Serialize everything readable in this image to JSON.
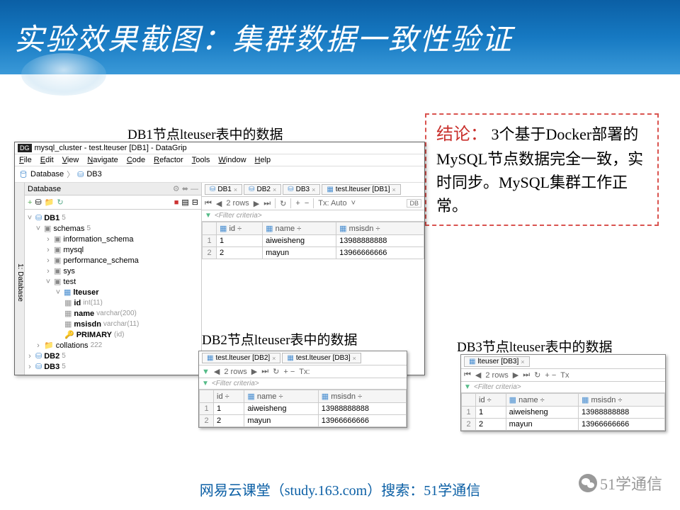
{
  "slide": {
    "title": "实验效果截图：集群数据一致性验证",
    "caption_db1": "DB1节点lteuser表中的数据",
    "caption_db2": "DB2节点lteuser表中的数据",
    "caption_db3": "DB3节点lteuser表中的数据"
  },
  "conclusion": {
    "lead": "结论：",
    "body": "3个基于Docker部署的MySQL节点数据完全一致，实时同步。MySQL集群工作正常。"
  },
  "datagrip": {
    "logo": "DG",
    "title": "mysql_cluster - test.lteuser [DB1] - DataGrip",
    "menu": [
      "File",
      "Edit",
      "View",
      "Navigate",
      "Code",
      "Refactor",
      "Tools",
      "Window",
      "Help"
    ],
    "breadcrumb": [
      "Database",
      "DB3"
    ],
    "panel_tab": "Database",
    "side_tab": "1: Database",
    "tree": {
      "db1": {
        "label": "DB1",
        "count": "5"
      },
      "schemas": {
        "label": "schemas",
        "count": "5"
      },
      "sch": [
        "information_schema",
        "mysql",
        "performance_schema",
        "sys",
        "test"
      ],
      "table": "lteuser",
      "cols": [
        {
          "n": "id",
          "t": "int(11)"
        },
        {
          "n": "name",
          "t": "varchar(200)"
        },
        {
          "n": "msisdn",
          "t": "varchar(11)"
        }
      ],
      "pk": {
        "n": "PRIMARY",
        "t": "(id)"
      },
      "collations": {
        "label": "collations",
        "count": "222"
      },
      "db2": {
        "label": "DB2",
        "count": "5"
      },
      "db3": {
        "label": "DB3",
        "count": "5"
      }
    },
    "tabs_main": [
      "DB1",
      "DB2",
      "DB3",
      "test.lteuser [DB1]"
    ],
    "rows_label": "2 rows",
    "tx": "Tx: Auto",
    "db_ind": "DB",
    "filter": "<Filter criteria>",
    "headers": [
      "id",
      "name",
      "msisdn"
    ],
    "data": [
      {
        "id": "1",
        "name": "aiweisheng",
        "msisdn": "13988888888"
      },
      {
        "id": "2",
        "name": "mayun",
        "msisdn": "13966666666"
      }
    ]
  },
  "panel2": {
    "tabs": [
      "test.lteuser [DB2]",
      "test.lteuser [DB3]"
    ],
    "rows_label": "2 rows",
    "tx": "Tx:",
    "filter": "<Filter criteria>",
    "headers": [
      "id",
      "name",
      "msisdn"
    ],
    "data": [
      {
        "id": "1",
        "name": "aiweisheng",
        "msisdn": "13988888888"
      },
      {
        "id": "2",
        "name": "mayun",
        "msisdn": "13966666666"
      }
    ]
  },
  "panel3": {
    "tabs": [
      "lteuser [DB3]"
    ],
    "rows_label": "2 rows",
    "tx": "Tx",
    "filter": "<Filter criteria>",
    "headers": [
      "id",
      "name",
      "msisdn"
    ],
    "data": [
      {
        "id": "1",
        "name": "aiweisheng",
        "msisdn": "13988888888"
      },
      {
        "id": "2",
        "name": "mayun",
        "msisdn": "13966666666"
      }
    ]
  },
  "footer": "网易云课堂（study.163.com）搜索：51学通信",
  "brand": "51学通信"
}
